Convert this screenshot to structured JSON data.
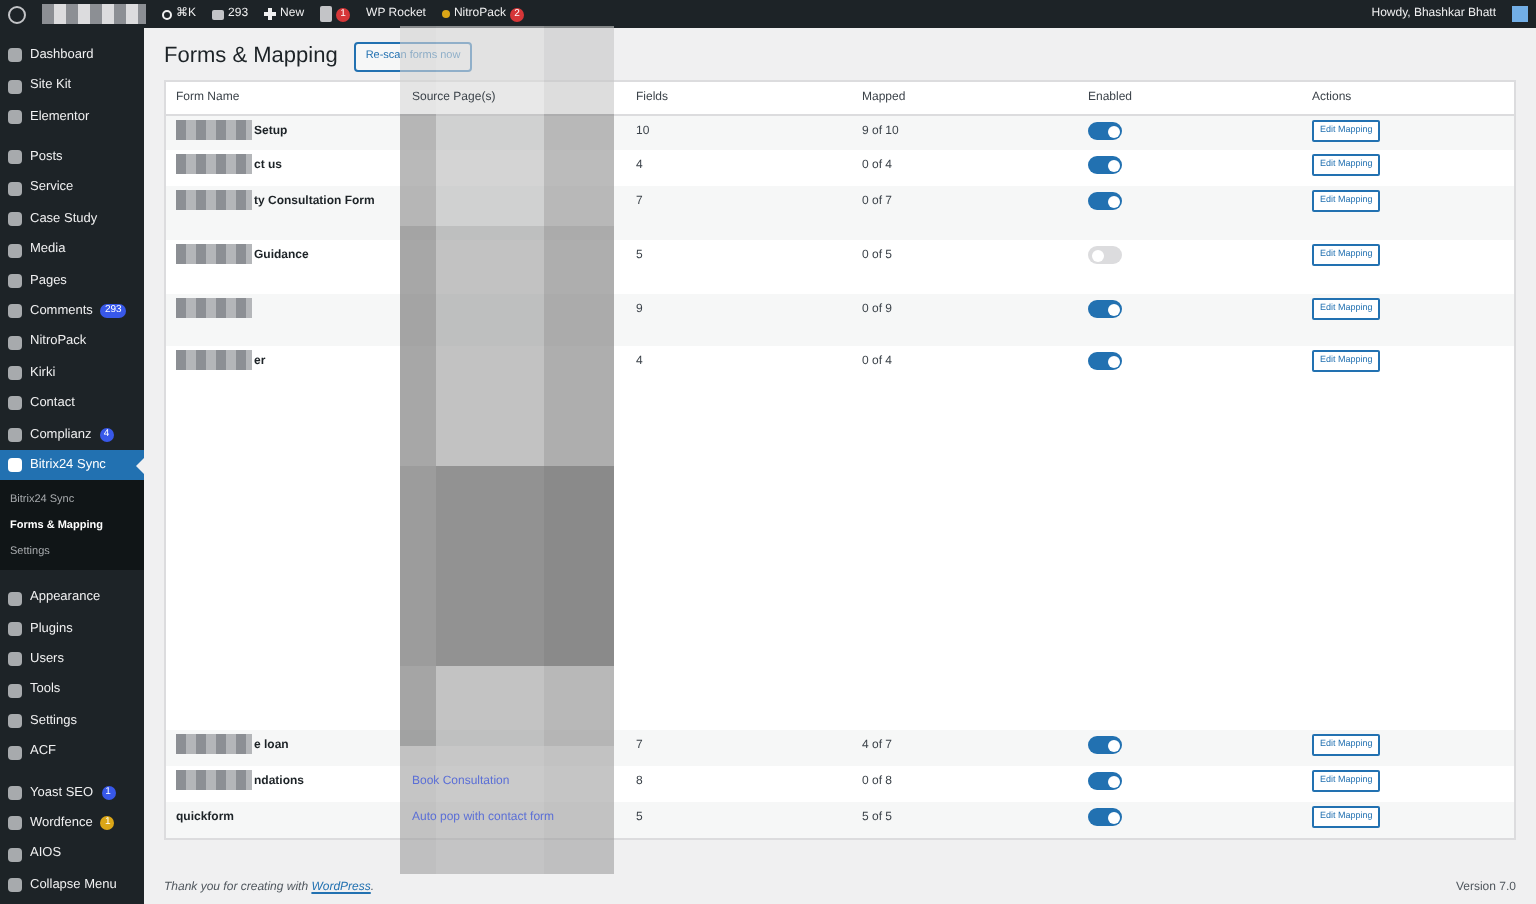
{
  "admin_bar": {
    "items": [
      {
        "kind": "search",
        "label": "⌘K"
      },
      {
        "kind": "comments",
        "label": "293"
      },
      {
        "kind": "new",
        "label": "New"
      },
      {
        "kind": "yoast",
        "badge": "1"
      },
      {
        "kind": "text",
        "label": "WP Rocket"
      },
      {
        "kind": "dot",
        "label": "NitroPack",
        "badge": "2"
      }
    ],
    "greeting": "Howdy, Bhashkar Bhatt"
  },
  "sidebar": {
    "groups": [
      {
        "items": [
          {
            "label": "Dashboard",
            "selected": false
          },
          {
            "label": "Site Kit",
            "selected": false
          },
          {
            "label": "Elementor",
            "selected": false
          }
        ]
      },
      {
        "items": [
          {
            "label": "Posts",
            "selected": false
          },
          {
            "label": "Service",
            "selected": false
          },
          {
            "label": "Case Study",
            "selected": false
          },
          {
            "label": "Media",
            "selected": false
          },
          {
            "label": "Pages",
            "selected": false
          },
          {
            "label": "Comments",
            "selected": false,
            "badge": "293",
            "color": "#3858e9"
          },
          {
            "label": "NitroPack",
            "selected": false
          },
          {
            "label": "Kirki",
            "selected": false
          },
          {
            "label": "Contact",
            "selected": false
          },
          {
            "label": "Complianz",
            "selected": false,
            "badge": "4",
            "color": "#3858e9"
          },
          {
            "label": "Bitrix24 Sync",
            "selected": true,
            "children": [
              {
                "label": "Bitrix24 Sync",
                "selected": false
              },
              {
                "label": "Forms & Mapping",
                "selected": true
              },
              {
                "label": "Settings",
                "selected": false
              }
            ]
          },
          {
            "label": "Appearance",
            "selected": false
          },
          {
            "label": "Plugins",
            "selected": false
          },
          {
            "label": "Users",
            "selected": false
          },
          {
            "label": "Tools",
            "selected": false
          },
          {
            "label": "Settings",
            "selected": false
          },
          {
            "label": "ACF",
            "selected": false
          }
        ]
      },
      {
        "items": [
          {
            "label": "Yoast SEO",
            "selected": false,
            "badge": "1",
            "color": "#3858e9"
          },
          {
            "label": "Wordfence",
            "selected": false,
            "badge": "1",
            "color": "#dba617"
          },
          {
            "label": "AIOS",
            "selected": false
          },
          {
            "label": "Collapse Menu",
            "selected": false
          }
        ]
      }
    ]
  },
  "page": {
    "title": "Forms & Mapping",
    "rescan_button": "Re-scan forms now"
  },
  "table": {
    "columns": [
      "Form Name",
      "Source Page(s)",
      "Fields",
      "Mapped",
      "Enabled",
      "Actions"
    ],
    "rows": [
      {
        "name": "Setup",
        "name_redacted": true,
        "fields": "10",
        "mapped": "9 of 10",
        "enabled": true,
        "action": "Edit Mapping"
      },
      {
        "name": "ct us",
        "name_redacted": true,
        "fields": "4",
        "mapped": "0 of 4",
        "enabled": true,
        "action": "Edit Mapping"
      },
      {
        "name": "ty Consultation Form",
        "name_redacted": true,
        "fields": "7",
        "mapped": "0 of 7",
        "enabled": true,
        "action": "Edit Mapping"
      },
      {
        "name": "Guidance",
        "name_redacted": true,
        "fields": "5",
        "mapped": "0 of 5",
        "enabled": false,
        "action": "Edit Mapping"
      },
      {
        "name_redacted": true,
        "fields": "9",
        "mapped": "0 of 9",
        "enabled": true,
        "action": "Edit Mapping"
      },
      {
        "name": "er",
        "name_redacted": true,
        "fields": "4",
        "mapped": "0 of 4",
        "enabled": true,
        "action": "Edit Mapping"
      },
      {
        "name": "e loan",
        "name_redacted": true,
        "fields": "7",
        "mapped": "4 of 7",
        "enabled": true,
        "action": "Edit Mapping"
      },
      {
        "name": "ndations",
        "name_redacted": true,
        "source": "Book Consultation",
        "fields": "8",
        "mapped": "0 of 8",
        "enabled": true,
        "action": "Edit Mapping"
      },
      {
        "name": "quickform",
        "name_redacted": false,
        "source": "Auto pop with contact form",
        "fields": "5",
        "mapped": "5 of 5",
        "enabled": true,
        "action": "Edit Mapping"
      }
    ]
  },
  "footer": {
    "thanks": "Thank you for creating with",
    "link": "WordPress",
    "after": ".",
    "version": "Version 7.0"
  }
}
